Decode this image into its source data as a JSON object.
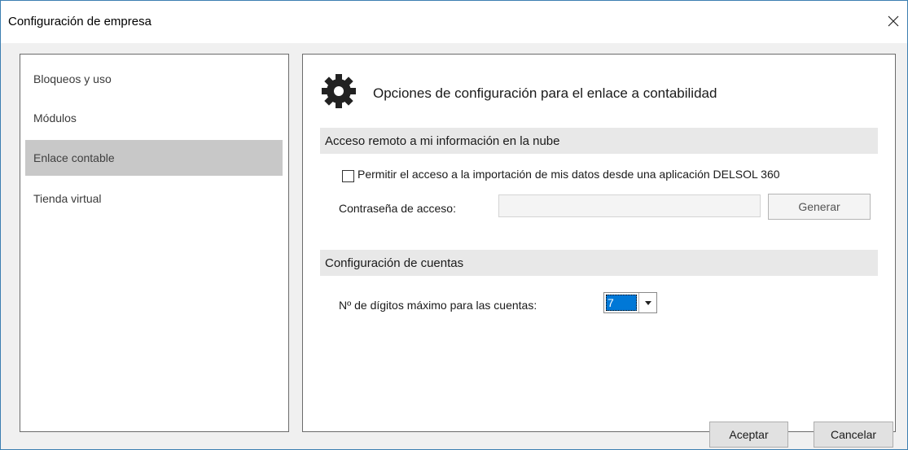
{
  "window": {
    "title": "Configuración de empresa"
  },
  "sidebar": {
    "items": [
      {
        "label": "Bloqueos y uso"
      },
      {
        "label": "Módulos"
      },
      {
        "label": "Enlace contable",
        "selected": true
      },
      {
        "label": "Tienda virtual"
      }
    ]
  },
  "main": {
    "header_title": "Opciones de configuración para el enlace a contabilidad",
    "header_icon": "gear-icon",
    "sections": {
      "remote": {
        "title": "Acceso remoto a mi información en la nube",
        "checkbox_label": "Permitir el acceso a la importación de mis datos desde una aplicación DELSOL 360",
        "checkbox_checked": false,
        "password_label": "Contraseña de acceso:",
        "password_value": "",
        "generate_label": "Generar"
      },
      "accounts": {
        "title": "Configuración de cuentas",
        "digits_label": "Nº de dígitos máximo para las cuentas:",
        "digits_value": "7"
      }
    }
  },
  "footer": {
    "accept_label": "Aceptar",
    "cancel_label": "Cancelar"
  },
  "colors": {
    "selection": "#0078d7",
    "window_border": "#3c7fb1",
    "sidebar_selected": "#c8c8c8"
  }
}
